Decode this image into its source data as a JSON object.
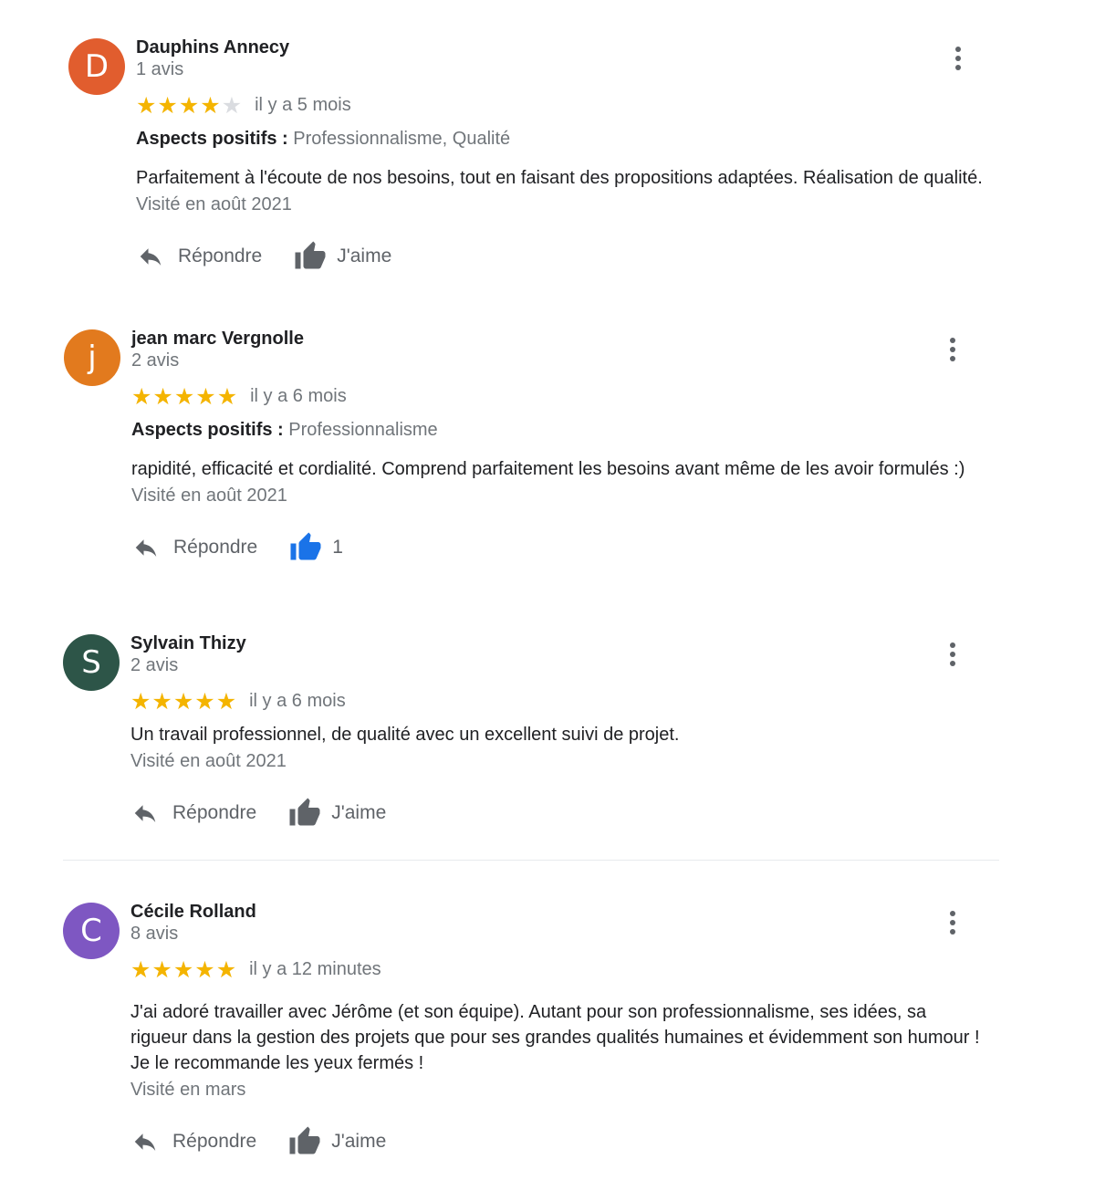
{
  "colors": {
    "star_filled": "#f4b400",
    "star_empty": "#dadce0",
    "like_active": "#1a73e8",
    "secondary_text": "#70757a"
  },
  "reviews": [
    {
      "avatar_letter": "D",
      "avatar_color": "#e15d2e",
      "name": "Dauphins Annecy",
      "review_count": "1 avis",
      "stars": 4,
      "time": "il y a 5 mois",
      "aspects_label": "Aspects positifs :",
      "aspects_value": "Professionnalisme, Qualité",
      "text": "Parfaitement à l'écoute de nos besoins, tout en faisant des propositions adaptées. Réalisation de qualité.",
      "visited": "Visité en août 2021",
      "reply_label": "Répondre",
      "like_label": "J'aime",
      "like_icon": "thumbs-up-icon",
      "liked": false
    },
    {
      "avatar_letter": "j",
      "avatar_color": "#e27a1e",
      "name": "jean marc Vergnolle",
      "review_count": "2 avis",
      "stars": 5,
      "time": "il y a 6 mois",
      "aspects_label": "Aspects positifs :",
      "aspects_value": "Professionnalisme",
      "text": "rapidité, efficacité et cordialité. Comprend parfaitement les besoins avant même de les avoir formulés :)",
      "visited": "Visité en août 2021",
      "reply_label": "Répondre",
      "like_label": "1",
      "like_icon": "thumbs-up-icon",
      "liked": true
    },
    {
      "avatar_letter": "S",
      "avatar_color": "#2d5548",
      "name": "Sylvain Thizy",
      "review_count": "2 avis",
      "stars": 5,
      "time": "il y a 6 mois",
      "text": "Un travail professionnel, de qualité avec un excellent suivi de projet.",
      "visited": "Visité en août 2021",
      "reply_label": "Répondre",
      "like_label": "J'aime",
      "like_icon": "thumbs-up-icon",
      "liked": false
    },
    {
      "avatar_letter": "C",
      "avatar_color": "#7e57c2",
      "name": "Cécile Rolland",
      "review_count": "8 avis",
      "stars": 5,
      "time": "il y a 12 minutes",
      "text_lines": [
        "J'ai adoré travailler avec Jérôme (et son équipe). Autant pour son professionnalisme, ses idées, sa",
        "rigueur dans la gestion des projets que pour ses grandes qualités humaines et évidemment son humour !",
        "Je le recommande les yeux fermés !"
      ],
      "visited": "Visité en mars",
      "reply_label": "Répondre",
      "like_label": "J'aime",
      "like_icon": "thumbs-up-icon",
      "liked": false
    }
  ]
}
